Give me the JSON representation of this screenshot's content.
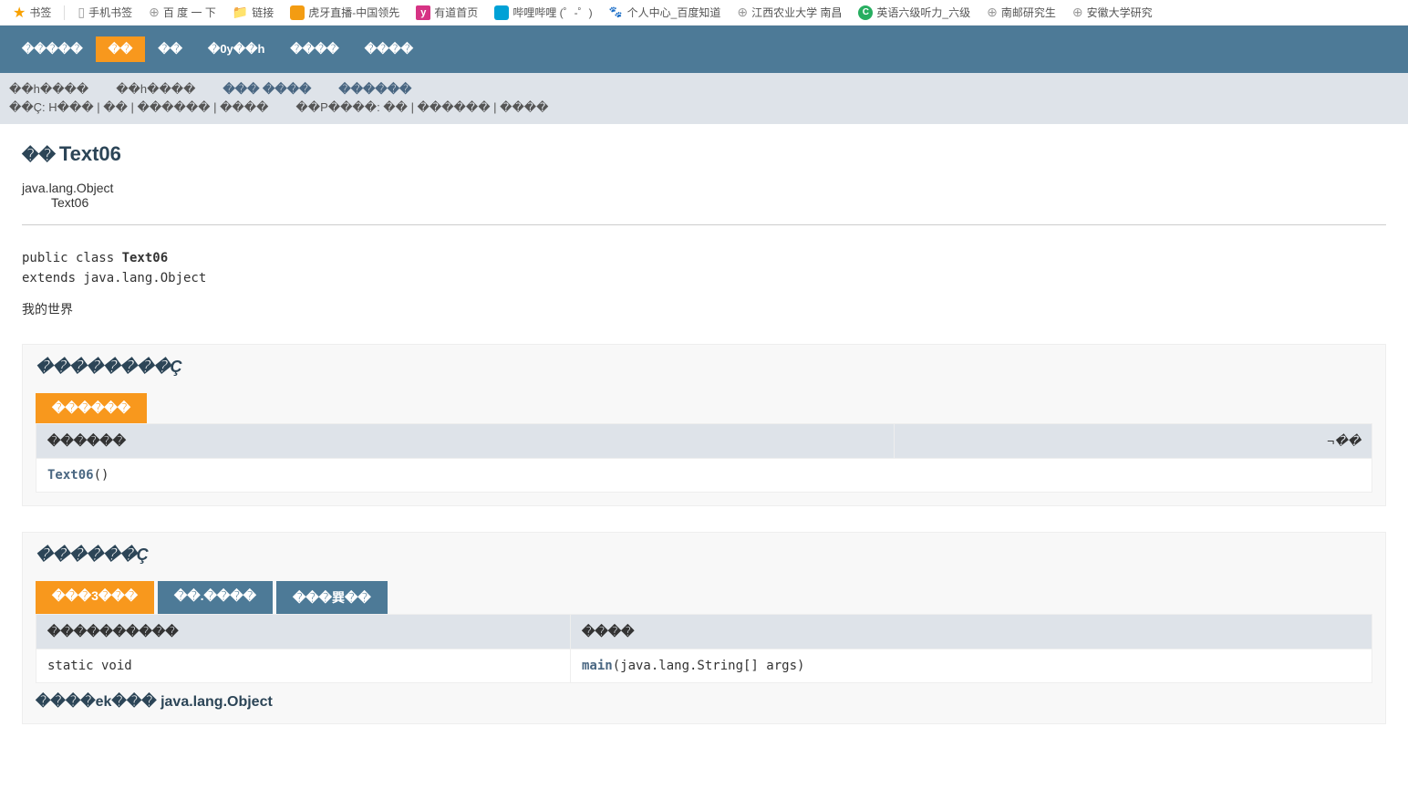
{
  "bookmarks": [
    {
      "icon": "star",
      "label": "书签"
    },
    {
      "icon": "phone",
      "label": "手机书签"
    },
    {
      "icon": "globe",
      "label": "百 度 一 下"
    },
    {
      "icon": "folder",
      "label": "链接"
    },
    {
      "icon": "huya",
      "label": "虎牙直播-中国领先"
    },
    {
      "icon": "youdao",
      "label": "有道首页"
    },
    {
      "icon": "bili",
      "label": "哔哩哔哩 (゜-゜)"
    },
    {
      "icon": "baidu",
      "label": "个人中心_百度知道"
    },
    {
      "icon": "globe",
      "label": "江西农业大学 南昌"
    },
    {
      "icon": "360",
      "label": "英语六级听力_六级"
    },
    {
      "icon": "globe",
      "label": "南邮研究生"
    },
    {
      "icon": "globe",
      "label": "安徽大学研究"
    }
  ],
  "topnav": {
    "items": [
      "�����",
      "��",
      "��",
      "�0y��h",
      "����",
      "����"
    ],
    "activeIndex": 1
  },
  "subnav": {
    "row1": [
      "��h����",
      "��h����",
      "���   ����",
      "������"
    ],
    "row2_left": "��Ç: H��� | �� | ������ | ����",
    "row2_right": "��P����: �� | ������ | ����"
  },
  "classHeader": {
    "prefix": "��",
    "name": "Text06"
  },
  "inheritance": {
    "parent": "java.lang.Object",
    "child": "Text06"
  },
  "declaration": {
    "line1_pre": "public class ",
    "line1_cls": "Text06",
    "line2": "extends java.lang.Object"
  },
  "description": "我的世界",
  "constructorSummary": {
    "title": "��������Ç",
    "tabs": [
      {
        "label": "������",
        "active": true
      }
    ],
    "headers": {
      "left": "������",
      "right": "¬��"
    },
    "rows": [
      {
        "name": "Text06",
        "paren": "()"
      }
    ]
  },
  "methodSummary": {
    "title": "������Ç",
    "tabs": [
      {
        "label": "���3���",
        "active": true
      },
      {
        "label": "��.����",
        "active": false
      },
      {
        "label": "���巽��",
        "active": false
      }
    ],
    "headers": {
      "left": "����������",
      "right": "����"
    },
    "rows": [
      {
        "modifier": "static void",
        "name": "main",
        "sig": "(java.lang.String[]  args)"
      }
    ],
    "inherited": "����ek��� java.lang.Object"
  }
}
